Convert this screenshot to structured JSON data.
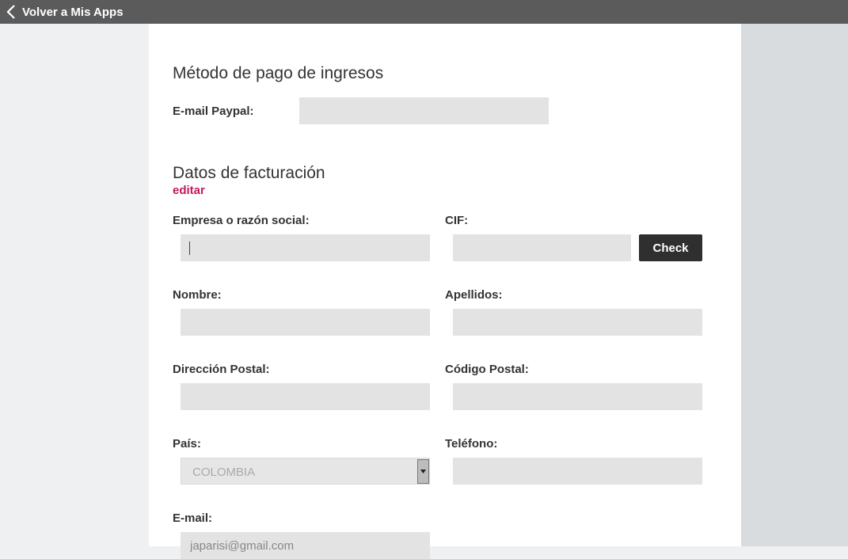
{
  "topbar": {
    "back_label": "Volver a Mis Apps"
  },
  "payment": {
    "title": "Método de pago de ingresos",
    "paypal_label": "E-mail Paypal:",
    "paypal_value": ""
  },
  "billing": {
    "title": "Datos de facturación",
    "edit_label": "editar",
    "company_label": "Empresa o razón social:",
    "company_value": "",
    "cif_label": "CIF:",
    "cif_value": "",
    "check_label": "Check",
    "first_name_label": "Nombre:",
    "first_name_value": "",
    "last_name_label": "Apellidos:",
    "last_name_value": "",
    "address_label": "Dirección Postal:",
    "address_value": "",
    "postal_label": "Código Postal:",
    "postal_value": "",
    "country_label": "País:",
    "country_value": "COLOMBIA",
    "phone_label": "Teléfono:",
    "phone_value": "",
    "email_label": "E-mail:",
    "email_value": "japarisi@gmail.com"
  },
  "colors": {
    "accent": "#c2185b",
    "topbar": "#5b5b5b",
    "field": "#e3e3e3",
    "button": "#2f2f2f"
  },
  "icons": {
    "back": "chevron-left-icon",
    "select": "caret-down-icon"
  }
}
